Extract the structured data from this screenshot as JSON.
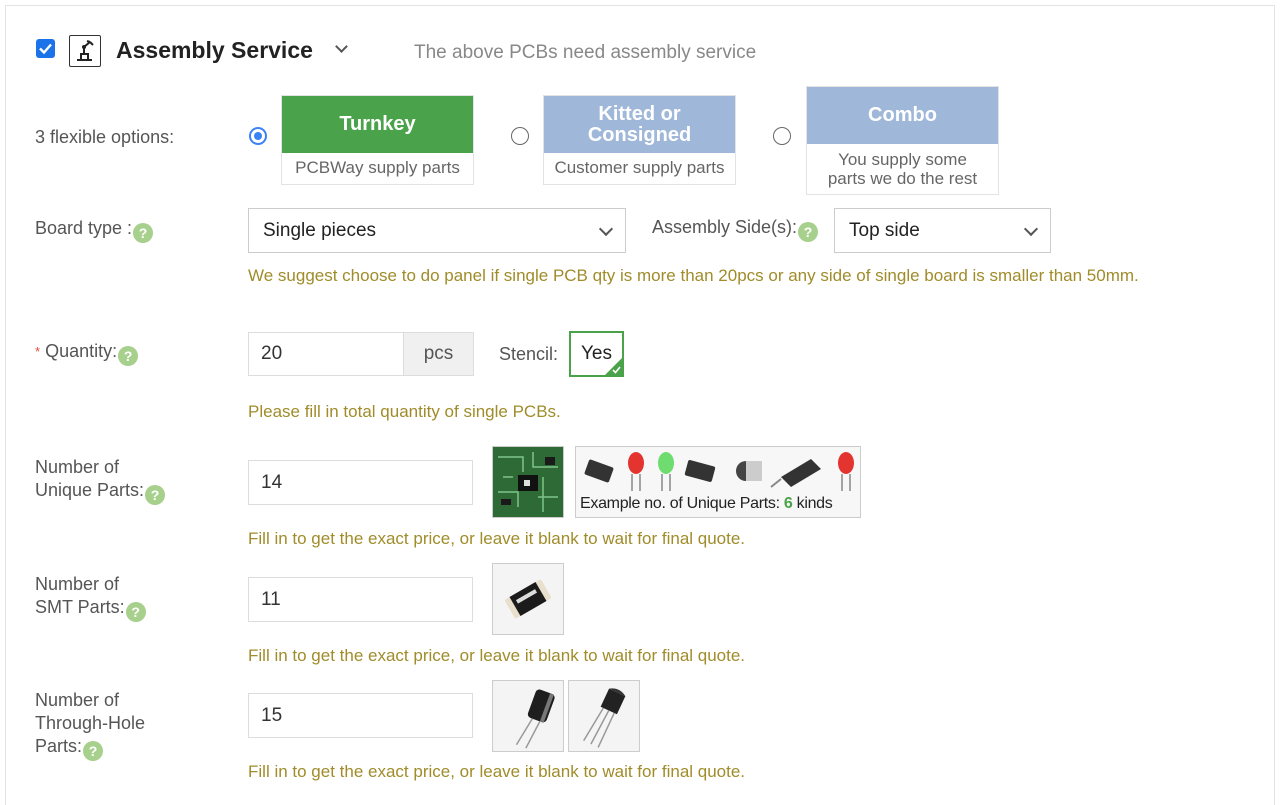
{
  "header": {
    "title": "Assembly Service",
    "description": "The above PCBs need assembly service",
    "enabled": true
  },
  "options": {
    "label": "3 flexible options:",
    "items": [
      {
        "title": "Turnkey",
        "subtitle": "PCBWay supply parts",
        "selected": true,
        "color": "#4aa24a"
      },
      {
        "title": "Kitted or Consigned",
        "subtitle": "Customer supply parts",
        "selected": false,
        "color": "#9fb7d9"
      },
      {
        "title": "Combo",
        "subtitle": "You supply some parts we do the rest",
        "selected": false,
        "color": "#9fb7d9"
      }
    ]
  },
  "board_type": {
    "label": "Board type :",
    "value": "Single pieces",
    "side_label": "Assembly Side(s):",
    "side_value": "Top side",
    "hint": "We suggest choose to do panel if single PCB qty is more than 20pcs or any side of single board is smaller than 50mm."
  },
  "quantity": {
    "required_mark": "*",
    "label": "Quantity:",
    "value": "20",
    "unit": "pcs",
    "stencil_label": "Stencil:",
    "stencil_value": "Yes",
    "hint": "Please fill in total quantity of single PCBs."
  },
  "unique_parts": {
    "label_line1": "Number of",
    "label_line2": "Unique Parts:",
    "value": "14",
    "example_prefix": "Example no. of Unique Parts: ",
    "example_count": "6",
    "example_suffix": " kinds",
    "hint": "Fill in to get the exact price, or leave it blank to wait for final quote."
  },
  "smt_parts": {
    "label_line1": "Number of",
    "label_line2": "SMT Parts:",
    "value": "11",
    "hint": "Fill in to get the exact price, or leave it blank to wait for final quote."
  },
  "through_hole_parts": {
    "label_line1": "Number of",
    "label_line2": "Through-Hole",
    "label_line3": "Parts:",
    "value": "15",
    "hint": "Fill in to get the exact price, or leave it blank to wait for final quote."
  },
  "help_glyph": "?",
  "colors": {
    "accent_green": "#4aa24a",
    "hint_text": "#a08c2a",
    "help_icon": "#a8d08d",
    "radio_selected": "#3b82f6"
  }
}
